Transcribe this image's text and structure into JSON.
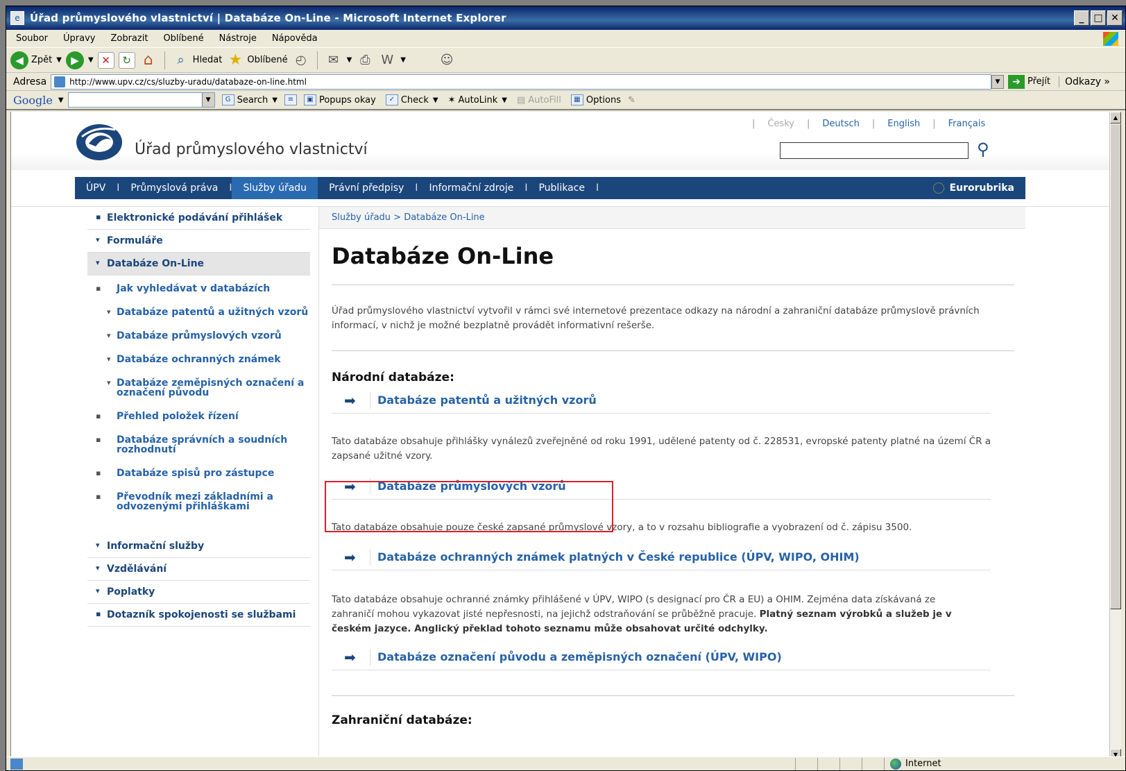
{
  "window": {
    "title": "Úřad průmyslového vlastnictví | Databáze On-Line - Microsoft Internet Explorer",
    "min": "_",
    "max": "□",
    "close": "✕"
  },
  "menubar": [
    "Soubor",
    "Úpravy",
    "Zobrazit",
    "Oblíbené",
    "Nástroje",
    "Nápověda"
  ],
  "toolbar": {
    "back": "Zpět",
    "search": "Hledat",
    "favorites": "Oblíbené"
  },
  "addressbar": {
    "label": "Adresa",
    "url": "http://www.upv.cz/cs/sluzby-uradu/databaze-on-line.html",
    "go": "Přejít",
    "links": "Odkazy »"
  },
  "googlebar": {
    "logo": "Google",
    "search": "Search",
    "popups": "Popups okay",
    "check": "Check",
    "autolink": "AutoLink",
    "autofill": "AutoFill",
    "options": "Options"
  },
  "site": {
    "name": "Úřad průmyslového vlastnictví",
    "languages": [
      "Česky",
      "Deutsch",
      "English",
      "Français"
    ],
    "nav": [
      "ÚPV",
      "Průmyslová práva",
      "Služby úřadu",
      "Právní předpisy",
      "Informační zdroje",
      "Publikace"
    ],
    "nav_active": "Služby úřadu",
    "eurorubrika": "Eurorubrika"
  },
  "sidemenu": {
    "top_items": [
      "Elektronické podávání přihlášek",
      "Formuláře",
      "Databáze On-Line"
    ],
    "sub_items": [
      "Jak vyhledávat v databázích",
      "Databáze patentů a užitných vzorů",
      "Databáze průmyslových vzorů",
      "Databáze ochranných známek",
      "Databáze zeměpisných označení a označení původu",
      "Přehled položek řízení",
      "Databáze správních a soudních rozhodnutí",
      "Databáze spisů pro zástupce",
      "Převodník mezi základními a odvozenými přihláškami"
    ],
    "bottom_items": [
      "Informační služby",
      "Vzdělávání",
      "Poplatky",
      "Dotazník spokojenosti se službami"
    ]
  },
  "content": {
    "breadcrumb": "Služby úřadu > Databáze On-Line",
    "title": "Databáze On-Line",
    "intro": "Úřad průmyslového vlastnictví vytvořil v rámci své internetové prezentace odkazy na národní a zahraniční databáze průmyslově právních informací, v nichž je možné bezplatně provádět informativní rešerše.",
    "national_heading": "Národní databáze:",
    "links": [
      "Databáze patentů a užitných vzorů",
      "Databáze průmyslových vzorů",
      "Databáze ochranných známek platných v České republice (ÚPV, WIPO, OHIM)",
      "Databáze označení původu a zeměpisných označení (ÚPV, WIPO)"
    ],
    "desc_patents": "Tato databáze obsahuje přihlášky vynálezů zveřejněné od roku 1991, udělené patenty od č. 228531, evropské patenty platné na území ČR a zapsané užitné vzory.",
    "desc_designs": "Tato databáze obsahuje pouze české zapsané průmyslové vzory, a to v rozsahu bibliografie a vyobrazení od č. zápisu 3500.",
    "desc_marks_normal": "Tato databáze obsahuje ochranné známky přihlášené v ÚPV, WIPO (s designací pro ČR a EU) a OHIM. Zejména data získávaná ze zahraničí mohou vykazovat jisté nepřesnosti, na jejichž odstraňování se průběžně pracuje. ",
    "desc_marks_bold": "Platný seznam výrobků a služeb je v českém jazyce. Anglický překlad tohoto seznamu může obsahovat určité odchylky.",
    "foreign_heading": "Zahraniční databáze:"
  },
  "statusbar": {
    "zone": "Internet"
  }
}
